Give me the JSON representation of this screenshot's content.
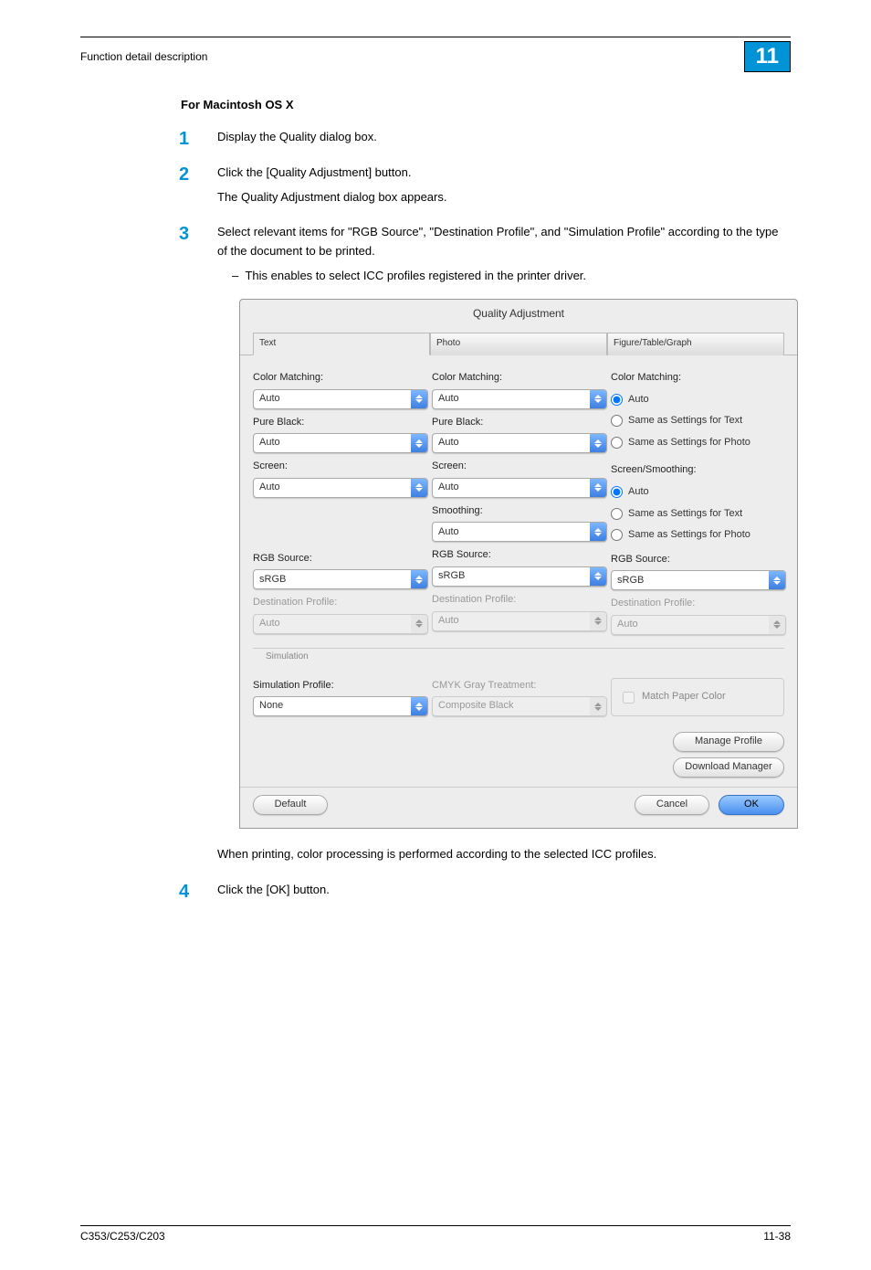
{
  "header": {
    "title": "Function detail description",
    "chapter": "11"
  },
  "section_heading": "For Macintosh OS X",
  "steps": [
    {
      "text": "Display the Quality dialog box."
    },
    {
      "text": "Click the [Quality Adjustment] button.",
      "continuation": "The Quality Adjustment dialog box appears."
    },
    {
      "text": "Select relevant items for \"RGB Source\", \"Destination Profile\", and \"Simulation Profile\" according to the type of the document to be printed.",
      "bullet": "This enables to select ICC profiles registered in the printer driver."
    },
    {
      "text": "Click the [OK] button."
    }
  ],
  "post_screenshot_text": "When printing, color processing is performed according to the selected ICC profiles.",
  "dialog": {
    "title": "Quality Adjustment",
    "tabs": [
      "Text",
      "Photo",
      "Figure/Table/Graph"
    ],
    "labels": {
      "color_matching": "Color Matching:",
      "pure_black": "Pure Black:",
      "screen": "Screen:",
      "smoothing": "Smoothing:",
      "rgb_source": "RGB Source:",
      "destination_profile": "Destination Profile:",
      "screen_smoothing": "Screen/Smoothing:",
      "simulation_header": "Simulation",
      "simulation_profile": "Simulation Profile:",
      "cmyk_gray": "CMYK Gray Treatment:"
    },
    "values": {
      "auto": "Auto",
      "srgb": "sRGB",
      "none": "None",
      "composite_black": "Composite Black"
    },
    "radios": {
      "auto": "Auto",
      "same_text": "Same as Settings for Text",
      "same_photo": "Same as Settings for Photo"
    },
    "checkbox": {
      "match_paper": "Match Paper Color"
    },
    "buttons": {
      "manage_profile": "Manage Profile",
      "download_manager": "Download Manager",
      "default": "Default",
      "cancel": "Cancel",
      "ok": "OK"
    }
  },
  "footer": {
    "left": "C353/C253/C203",
    "right": "11-38"
  }
}
